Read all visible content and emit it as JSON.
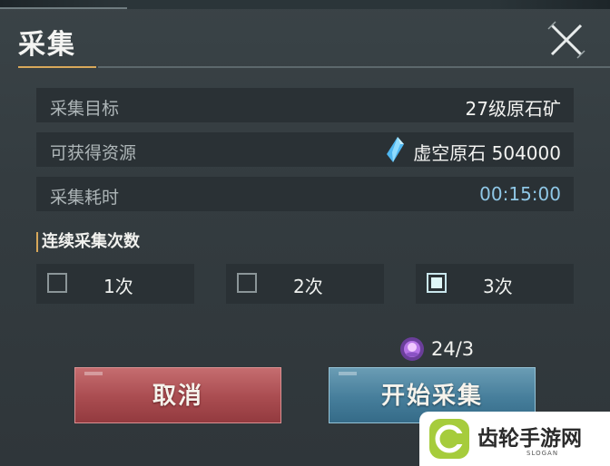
{
  "dialog": {
    "title": "采集",
    "close_icon": "close-icon"
  },
  "info_rows": [
    {
      "label": "采集目标",
      "value": "27级原石矿"
    },
    {
      "label": "可获得资源",
      "value": "虚空原石 504000",
      "icon": "blue-crystal-icon"
    },
    {
      "label": "采集耗时",
      "value": "00:15:00"
    }
  ],
  "count_section": {
    "title": "连续采集次数",
    "options": [
      {
        "label": "1次",
        "checked": false
      },
      {
        "label": "2次",
        "checked": false
      },
      {
        "label": "3次",
        "checked": true
      }
    ]
  },
  "cost": {
    "icon": "purple-energy-icon",
    "text": "24/3"
  },
  "buttons": {
    "cancel_label": "取消",
    "start_label": "开始采集"
  },
  "watermark": {
    "text": "齿轮手游网",
    "slogan": "SLOGAN"
  },
  "colors": {
    "accent_gold": "#d8a85a",
    "time_blue": "#8fc7e6",
    "cancel_red": "#a94c50",
    "start_blue": "#467e9b"
  }
}
